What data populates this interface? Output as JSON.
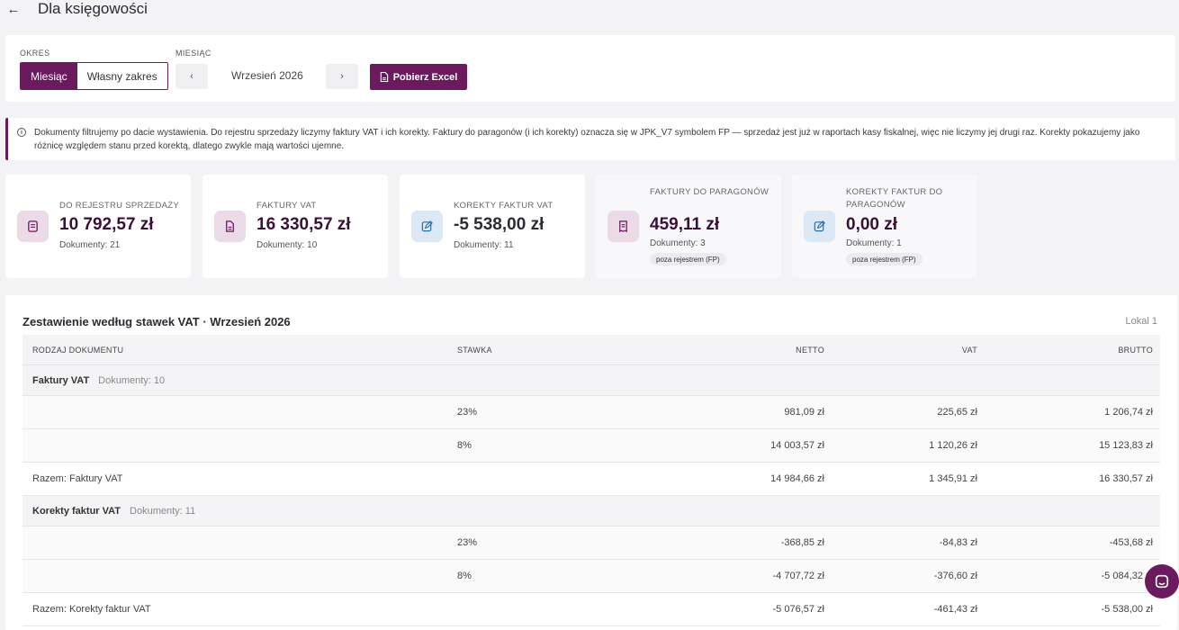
{
  "header": {
    "back_icon": "arrow-left-icon",
    "title": "Dla księgowości"
  },
  "filters": {
    "okres_label": "OKRES",
    "miesiac_label": "MIESIĄC",
    "segments": [
      {
        "label": "Miesiąc",
        "active": true
      },
      {
        "label": "Własny zakres",
        "active": false
      }
    ],
    "prev_icon": "chevron-left-icon",
    "next_icon": "chevron-right-icon",
    "month": "Wrzesień 2026",
    "excel_button": "Pobierz Excel"
  },
  "info": {
    "icon": "info-icon",
    "text": "Dokumenty filtrujemy po dacie wystawienia. Do rejestru sprzedaży liczymy faktury VAT i ich korekty. Faktury do paragonów (i ich korekty) oznacza się w JPK_V7 symbolem FP — sprzedaż jest już w raportach kasy fiskalnej, więc nie liczymy jej drugi raz. Korekty pokazujemy jako różnicę względem stanu przed korektą, dlatego zwykle mają wartości ujemne."
  },
  "cards": [
    {
      "label": "DO REJESTRU SPRZEDAŻY",
      "value": "10 792,57 zł",
      "docs": "Dokumenty: 21",
      "icon": "receipt-icon"
    },
    {
      "label": "FAKTURY VAT",
      "value": "16 330,57 zł",
      "docs": "Dokumenty: 10",
      "icon": "document-icon"
    },
    {
      "label": "KOREKTY FAKTUR VAT",
      "value": "-5 538,00 zł",
      "docs": "Dokumenty: 11",
      "icon": "edit-icon"
    },
    {
      "label": "FAKTURY DO PARAGONÓW",
      "value": "459,11 zł",
      "docs": "Dokumenty: 3",
      "badge": "poza rejestrem (FP)",
      "icon": "receipt-list-icon"
    },
    {
      "label": "KOREKTY FAKTUR DO PARAGONÓW",
      "value": "0,00 zł",
      "docs": "Dokumenty: 1",
      "badge": "poza rejestrem (FP)",
      "icon": "edit-icon"
    }
  ],
  "table": {
    "title": "Zestawienie według stawek VAT · Wrzesień 2026",
    "lokal": "Lokal 1",
    "columns": [
      "RODZAJ DOKUMENTU",
      "STAWKA",
      "NETTO",
      "VAT",
      "BRUTTO"
    ],
    "groups": [
      {
        "name": "Faktury VAT",
        "docs": "Dokumenty: 10",
        "rows": [
          {
            "rate": "23%",
            "netto": "981,09 zł",
            "vat": "225,65 zł",
            "brutto": "1 206,74 zł"
          },
          {
            "rate": "8%",
            "netto": "14 003,57 zł",
            "vat": "1 120,26 zł",
            "brutto": "15 123,83 zł"
          }
        ],
        "total": {
          "label": "Razem: Faktury VAT",
          "netto": "14 984,66 zł",
          "vat": "1 345,91 zł",
          "brutto": "16 330,57 zł"
        }
      },
      {
        "name": "Korekty faktur VAT",
        "docs": "Dokumenty: 11",
        "rows": [
          {
            "rate": "23%",
            "netto": "-368,85 zł",
            "vat": "-84,83 zł",
            "brutto": "-453,68 zł"
          },
          {
            "rate": "8%",
            "netto": "-4 707,72 zł",
            "vat": "-376,60 zł",
            "brutto": "-5 084,32 zł"
          }
        ],
        "total": {
          "label": "Razem: Korekty faktur VAT",
          "netto": "-5 076,57 zł",
          "vat": "-461,43 zł",
          "brutto": "-5 538,00 zł"
        }
      }
    ]
  },
  "chat": {
    "icon": "chat-icon"
  },
  "colors": {
    "accent": "#6b1a5e",
    "accent_light": "#eadbe7",
    "blue_light": "#dce9f5",
    "background": "#f3f3f5"
  }
}
